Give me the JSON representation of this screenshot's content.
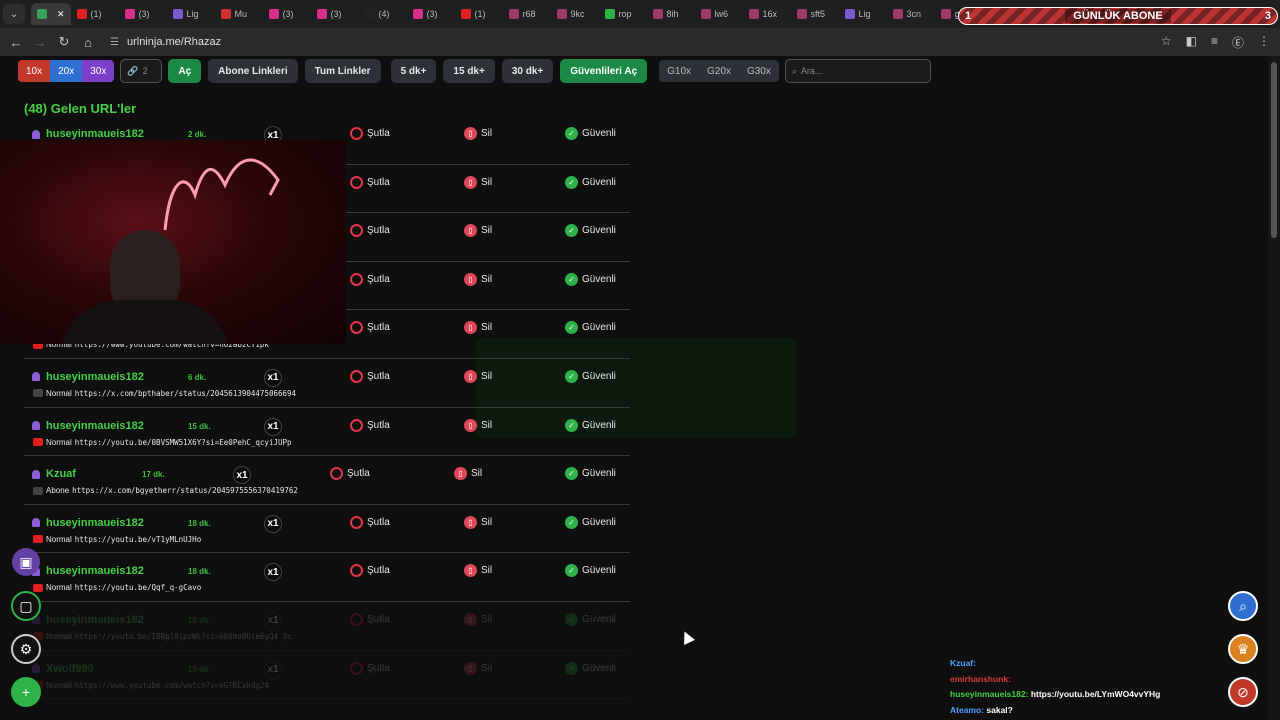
{
  "browser": {
    "tabs": [
      {
        "label": "",
        "color": "#3aa35b"
      },
      {
        "label": "(1)",
        "color": "#e01f1f"
      },
      {
        "label": "(3)",
        "color": "#d62f8c"
      },
      {
        "label": "Lig",
        "color": "#7b5ad0"
      },
      {
        "label": "Mu",
        "color": "#d23030"
      },
      {
        "label": "(3)",
        "color": "#d62f8c"
      },
      {
        "label": "(3)",
        "color": "#d62f8c"
      },
      {
        "label": "(4)",
        "color": "#222222"
      },
      {
        "label": "(3)",
        "color": "#d62f8c"
      },
      {
        "label": "(1)",
        "color": "#e01f1f"
      },
      {
        "label": "r68",
        "color": "#a03a6a"
      },
      {
        "label": "9kc",
        "color": "#a03a6a"
      },
      {
        "label": "rop",
        "color": "#2bb24a"
      },
      {
        "label": "8ih",
        "color": "#a03a6a"
      },
      {
        "label": "lw6",
        "color": "#a03a6a"
      },
      {
        "label": "16x",
        "color": "#a03a6a"
      },
      {
        "label": "sft5",
        "color": "#a03a6a"
      },
      {
        "label": "Lig",
        "color": "#7b5ad0"
      },
      {
        "label": "3cn",
        "color": "#a03a6a"
      },
      {
        "label": "gpx",
        "color": "#a03a6a"
      }
    ],
    "url": "urlninja.me/Rhazaz",
    "overlay": {
      "left": "1",
      "title": "GÜNLÜK ABONE",
      "right": "3"
    }
  },
  "toolbar": {
    "mult": [
      "10x",
      "20x",
      "30x"
    ],
    "mult_colors": [
      "#c0392b",
      "#2f6fd1",
      "#7b3fc9"
    ],
    "count": "2",
    "open": "Aç",
    "subs_links": "Abone Linkleri",
    "all_links": "Tum Linkler",
    "t5": "5 dk+",
    "t15": "15 dk+",
    "t30": "30 dk+",
    "open_safe": "Güvenlileri Aç",
    "g": [
      "G10x",
      "G20x",
      "G30x"
    ],
    "search_placeholder": "Ara..."
  },
  "heading": "(48) Gelen URL'ler",
  "actions": {
    "skip": "Şutla",
    "delete": "Sil",
    "safe": "Güvenli"
  },
  "rows": [
    {
      "user": "huseyinmaueis182",
      "age": "2 dk.",
      "count": "x1",
      "type": "",
      "link": "",
      "source": "youtube"
    },
    {
      "user": "",
      "age": "",
      "count": "",
      "type": "",
      "link": "",
      "source": "youtube"
    },
    {
      "user": "",
      "age": "",
      "count": "",
      "type": "",
      "link": "",
      "source": "youtube"
    },
    {
      "user": "",
      "age": "",
      "count": "",
      "type": "",
      "link": "",
      "source": "youtube"
    },
    {
      "user": "",
      "age": "",
      "count": "",
      "type": "Normal",
      "link": "https://www.youtube.com/watch?v=hO2abzCY1pk",
      "source": "youtube"
    },
    {
      "user": "huseyinmaueis182",
      "age": "6 dk.",
      "count": "x1",
      "type": "Normal",
      "link": "https://x.com/bpthaber/status/2045613904475066694",
      "source": "x"
    },
    {
      "user": "huseyinmaueis182",
      "age": "15 dk.",
      "count": "x1",
      "type": "Normal",
      "link": "https://youtu.be/0BVSMW51X6Y?si=Ee0PehC_qcyiJUPp",
      "source": "youtube"
    },
    {
      "user": "Kzuaf",
      "age": "17 dk.",
      "count": "x1",
      "type": "Abone",
      "link": "https://x.com/bgyetherr/status/2045975556370419762",
      "source": "x"
    },
    {
      "user": "huseyinmaueis182",
      "age": "18 dk.",
      "count": "x1",
      "type": "Normal",
      "link": "https://youtu.be/vT1yMLnUJHo",
      "source": "youtube"
    },
    {
      "user": "huseyinmaueis182",
      "age": "18 dk.",
      "count": "x1",
      "type": "Normal",
      "link": "https://youtu.be/Qqf_q-gCavo",
      "source": "youtube"
    },
    {
      "user": "huseyinmaueis182",
      "age": "18 dk.",
      "count": "x1",
      "type": "Normal",
      "link": "https://youtu.be/I8Rg18jpzWc?si=6bVmo0Oie6gQ4_3c",
      "source": "youtube"
    },
    {
      "user": "Xwolf990",
      "age": "19 dk.",
      "count": "x1",
      "type": "Normal",
      "link": "https://www.youtube.com/watch?v=eGTKCxkdg24",
      "source": "youtube"
    }
  ],
  "chat": [
    {
      "user": "Kzuaf:",
      "msg": "",
      "color": "#4aa3ff"
    },
    {
      "user": "emirhanshunk:",
      "msg": "",
      "color": "#d33a3a"
    },
    {
      "user": "huseyinmaueis182:",
      "msg": "https://youtu.be/LYmWO4vvYHg",
      "color": "#46d146"
    },
    {
      "user": "Ateamo:",
      "msg": "sakal?",
      "color": "#4aa3ff"
    }
  ],
  "icons": {
    "sidebar": [
      "twitch-icon",
      "kick-icon",
      "settings-icon",
      "add-user-icon"
    ],
    "right": [
      "search-icon",
      "trophy-icon",
      "user-remove-icon"
    ]
  }
}
